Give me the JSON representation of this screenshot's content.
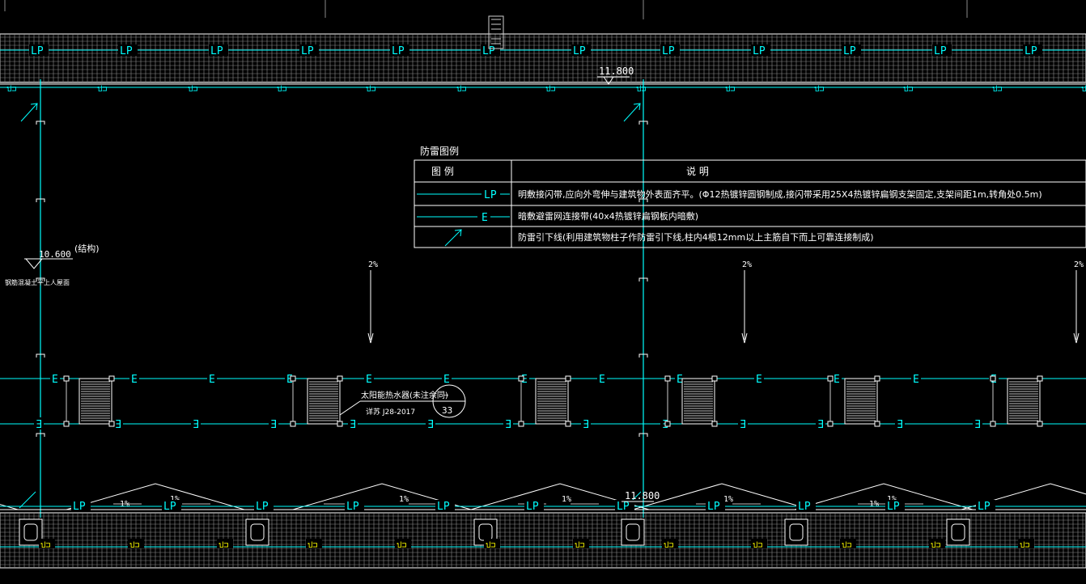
{
  "drawing": {
    "colors": {
      "background": "#000000",
      "cyan": "#00ffff",
      "white": "#ffffff",
      "grey": "#8a8a8a",
      "yellow": "#ffff00",
      "green": "#00ff66"
    },
    "top_band": {
      "lp_label": "LP",
      "dl_label": "ป⊐",
      "elevation": "11.800"
    },
    "left_note": {
      "elevation": "10.600",
      "struct_label": "(结构)",
      "note": "钢筋混凝土平上人屋面"
    },
    "legend": {
      "heading": "防雷图例",
      "col_symbol": "图    例",
      "col_desc": "说        明",
      "rows": [
        {
          "symbol_label": "LP",
          "description": "明敷接闪带,应向外弯伸与建筑物外表面齐平。(Φ12热镀锌圆钢制成,接闪带采用25X4热镀锌扁钢支架固定,支架间距1m,转角处0.5m)"
        },
        {
          "symbol_label": "E",
          "description": "暗敷避雷网连接带(40x4热镀锌扁钢板内暗敷)"
        },
        {
          "symbol_label": "",
          "description": "防雷引下线(利用建筑物柱子作防雷引下线,柱内4根12mm以上主筋自下而上可靠连接制成)"
        }
      ]
    },
    "slope_top": "2%",
    "mesh_label": "E",
    "mesh_label_bottom": "Ǝ",
    "solar_note": {
      "line1": "太阳能热水器(未注余同)",
      "line2": "详苏 J28-2017",
      "circle_top": "—",
      "circle_bottom": "33"
    },
    "bottom_band": {
      "slope": "1%",
      "lp_label": "LP",
      "elevation": "11.800",
      "dl_label": "ป⊐"
    }
  }
}
